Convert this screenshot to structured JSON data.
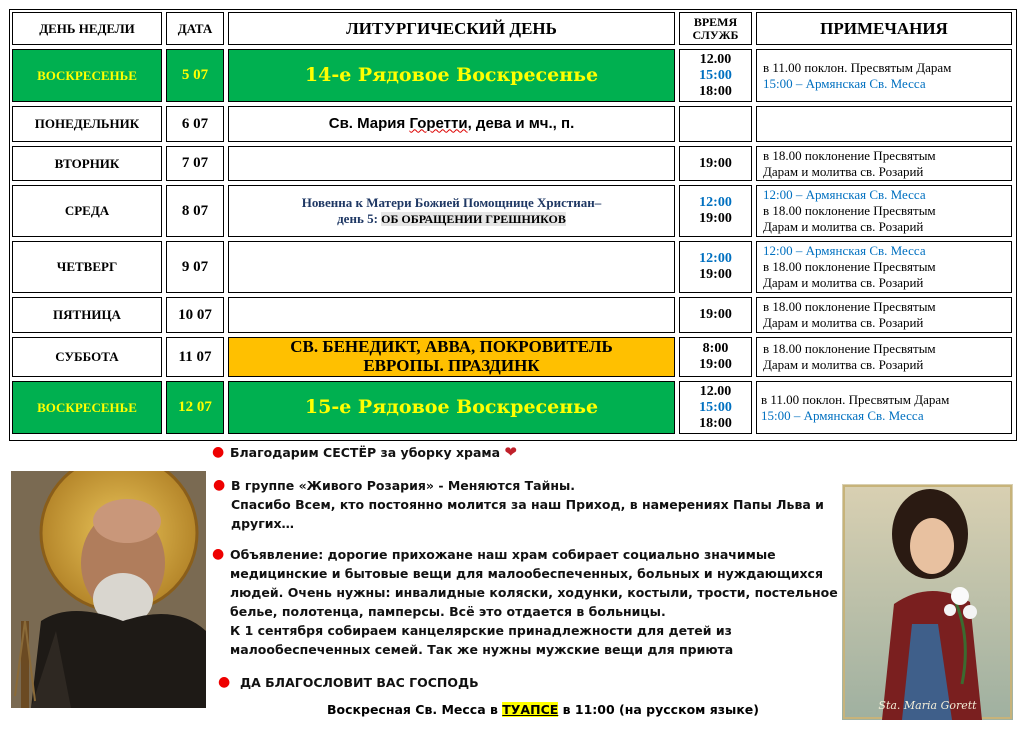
{
  "header": {
    "day": "ДЕНЬ НЕДЕЛИ",
    "date": "ДАТА",
    "liturgical": "ЛИТУРГИЧЕСКИЙ ДЕНЬ",
    "time_l1": "ВРЕМЯ",
    "time_l2": "СЛУЖБ",
    "notes": "ПРИМЕЧАНИЯ"
  },
  "rows": [
    {
      "day": "ВОСКРЕСЕНЬЕ",
      "date": "5 07",
      "lit": "14-е Рядовое Воскресенье",
      "times": [
        "12.00",
        "15:00",
        "18:00"
      ],
      "notes": [
        "в 11.00 поклон. Пресвятым Дарам",
        "15:00 – Армянская Св. Месса"
      ]
    },
    {
      "day": "ПОНЕДЕЛЬНИК",
      "date": "6 07",
      "lit_a": "Св. Мария ",
      "lit_b": "Горетти",
      "lit_c": ", дева и мч., п."
    },
    {
      "day": "ВТОРНИК",
      "date": "7 07",
      "times": [
        "19:00"
      ],
      "notes": [
        "в 18.00 поклонение Пресвятым",
        "Дарам и молитва св. Розарий"
      ]
    },
    {
      "day": "СРЕДА",
      "date": "8 07",
      "lit_l1": "Новенна к Матери Божией Помощнице Христиан–",
      "lit_l2": "день 5: ",
      "lit_l3": "ОБ ОБРАЩЕНИИ ГРЕШНИКОВ",
      "times": [
        "12:00",
        "19:00"
      ],
      "notes": [
        "12:00 – Армянская Св. Месса",
        "в 18.00 поклонение Пресвятым",
        "Дарам и молитва св. Розарий"
      ]
    },
    {
      "day": "ЧЕТВЕРГ",
      "date": "9 07",
      "times": [
        "12:00",
        "19:00"
      ],
      "notes": [
        "12:00 – Армянская Св. Месса",
        "в 18.00 поклонение Пресвятым",
        "Дарам и молитва св. Розарий"
      ]
    },
    {
      "day": "ПЯТНИЦА",
      "date": "10 07",
      "times": [
        "19:00"
      ],
      "notes": [
        "в 18.00 поклонение Пресвятым",
        "Дарам и молитва св. Розарий"
      ]
    },
    {
      "day": "СУББОТА",
      "date": "11 07",
      "lit_l1": "СВ. БЕНЕДИКТ, АВВА, ПОКРОВИТЕЛЬ",
      "lit_l2": "ЕВРОПЫ. ПРАЗДИНК",
      "times": [
        "8:00",
        "19:00"
      ],
      "notes": [
        "в 18.00 поклонение Пресвятым",
        "Дарам и молитва св. Розарий"
      ]
    },
    {
      "day": "ВОСКРЕСЕНЬЕ",
      "date": "12 07",
      "lit": "15-е Рядовое Воскресенье",
      "times": [
        "12.00",
        "15:00",
        "18:00"
      ],
      "notes": [
        "в 11.00 поклон. Пресвятым Дарам",
        "15:00 – Армянская Св. Месса"
      ]
    }
  ],
  "announcements": {
    "b1": "Благодарим СЕСТЁР за уборку храма",
    "b2": [
      "В группе «Живого Розария» - Меняются Тайны.",
      "Спасибо Всем, кто постоянно молится за наш Приход, в намерениях Папы Льва и",
      "других…"
    ],
    "b3": [
      "Объявление: дорогие прихожане наш храм собирает социально значимые",
      "медицинские и бытовые вещи для малообеспеченных, больных и нуждающихся",
      "людей. Очень нужны: инвалидные коляски, ходунки, костыли, трости, постельное",
      "белье, полотенца, памперсы. Всё это отдается в больницы.",
      "К 1 сентября собираем канцелярские принадлежности для детей из",
      "малообеспеченных семей. Так же нужны мужские вещи для приюта"
    ],
    "b4": "ДА БЛАГОСЛОВИТ ВАС ГОСПОДЬ",
    "footer_a": "Воскресная Св. Месса в ",
    "footer_city": "ТУАПСЕ",
    "footer_b": " в 11:00 (на русском языке)"
  },
  "images": {
    "right_caption": "Sta. Maria Gorett"
  },
  "colors": {
    "sunday_bg": "#00b050",
    "sunday_text": "#ffff00",
    "feast_bg": "#ffc000",
    "blue_text": "#0070c0",
    "bullet": "#e00000"
  }
}
